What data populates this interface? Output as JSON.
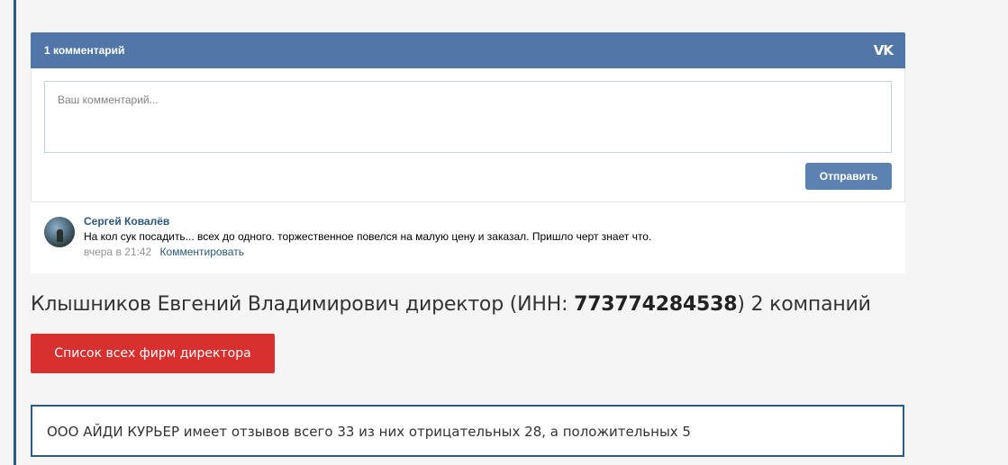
{
  "comments_widget": {
    "title": "1 комментарий",
    "logo": "VK",
    "textarea_placeholder": "Ваш комментарий...",
    "submit_label": "Отправить",
    "comment": {
      "author": "Сергей Ковалёв",
      "text": "На кол сук посадить... всех до одного. торжественное повелся на малую цену и заказал. Пришло черт знает что.",
      "time": "вчера в 21:42",
      "reply_label": "Комментировать"
    }
  },
  "director": {
    "prefix": "Клышников Евгений Владимирович директор (ИНН: ",
    "inn": "773774284538",
    "suffix": ") 2 компаний"
  },
  "firms_button_label": "Список всех фирм директора",
  "reviews_summary": "ООО АЙДИ КУРЬЕР имеет отзывов всего 33 из них отрицательных 28, а положительных 5",
  "colors": {
    "vk_header": "#5077a8",
    "vk_button": "#5b82b0",
    "red_button": "#d8302f",
    "accent_border": "#2c5b88"
  }
}
